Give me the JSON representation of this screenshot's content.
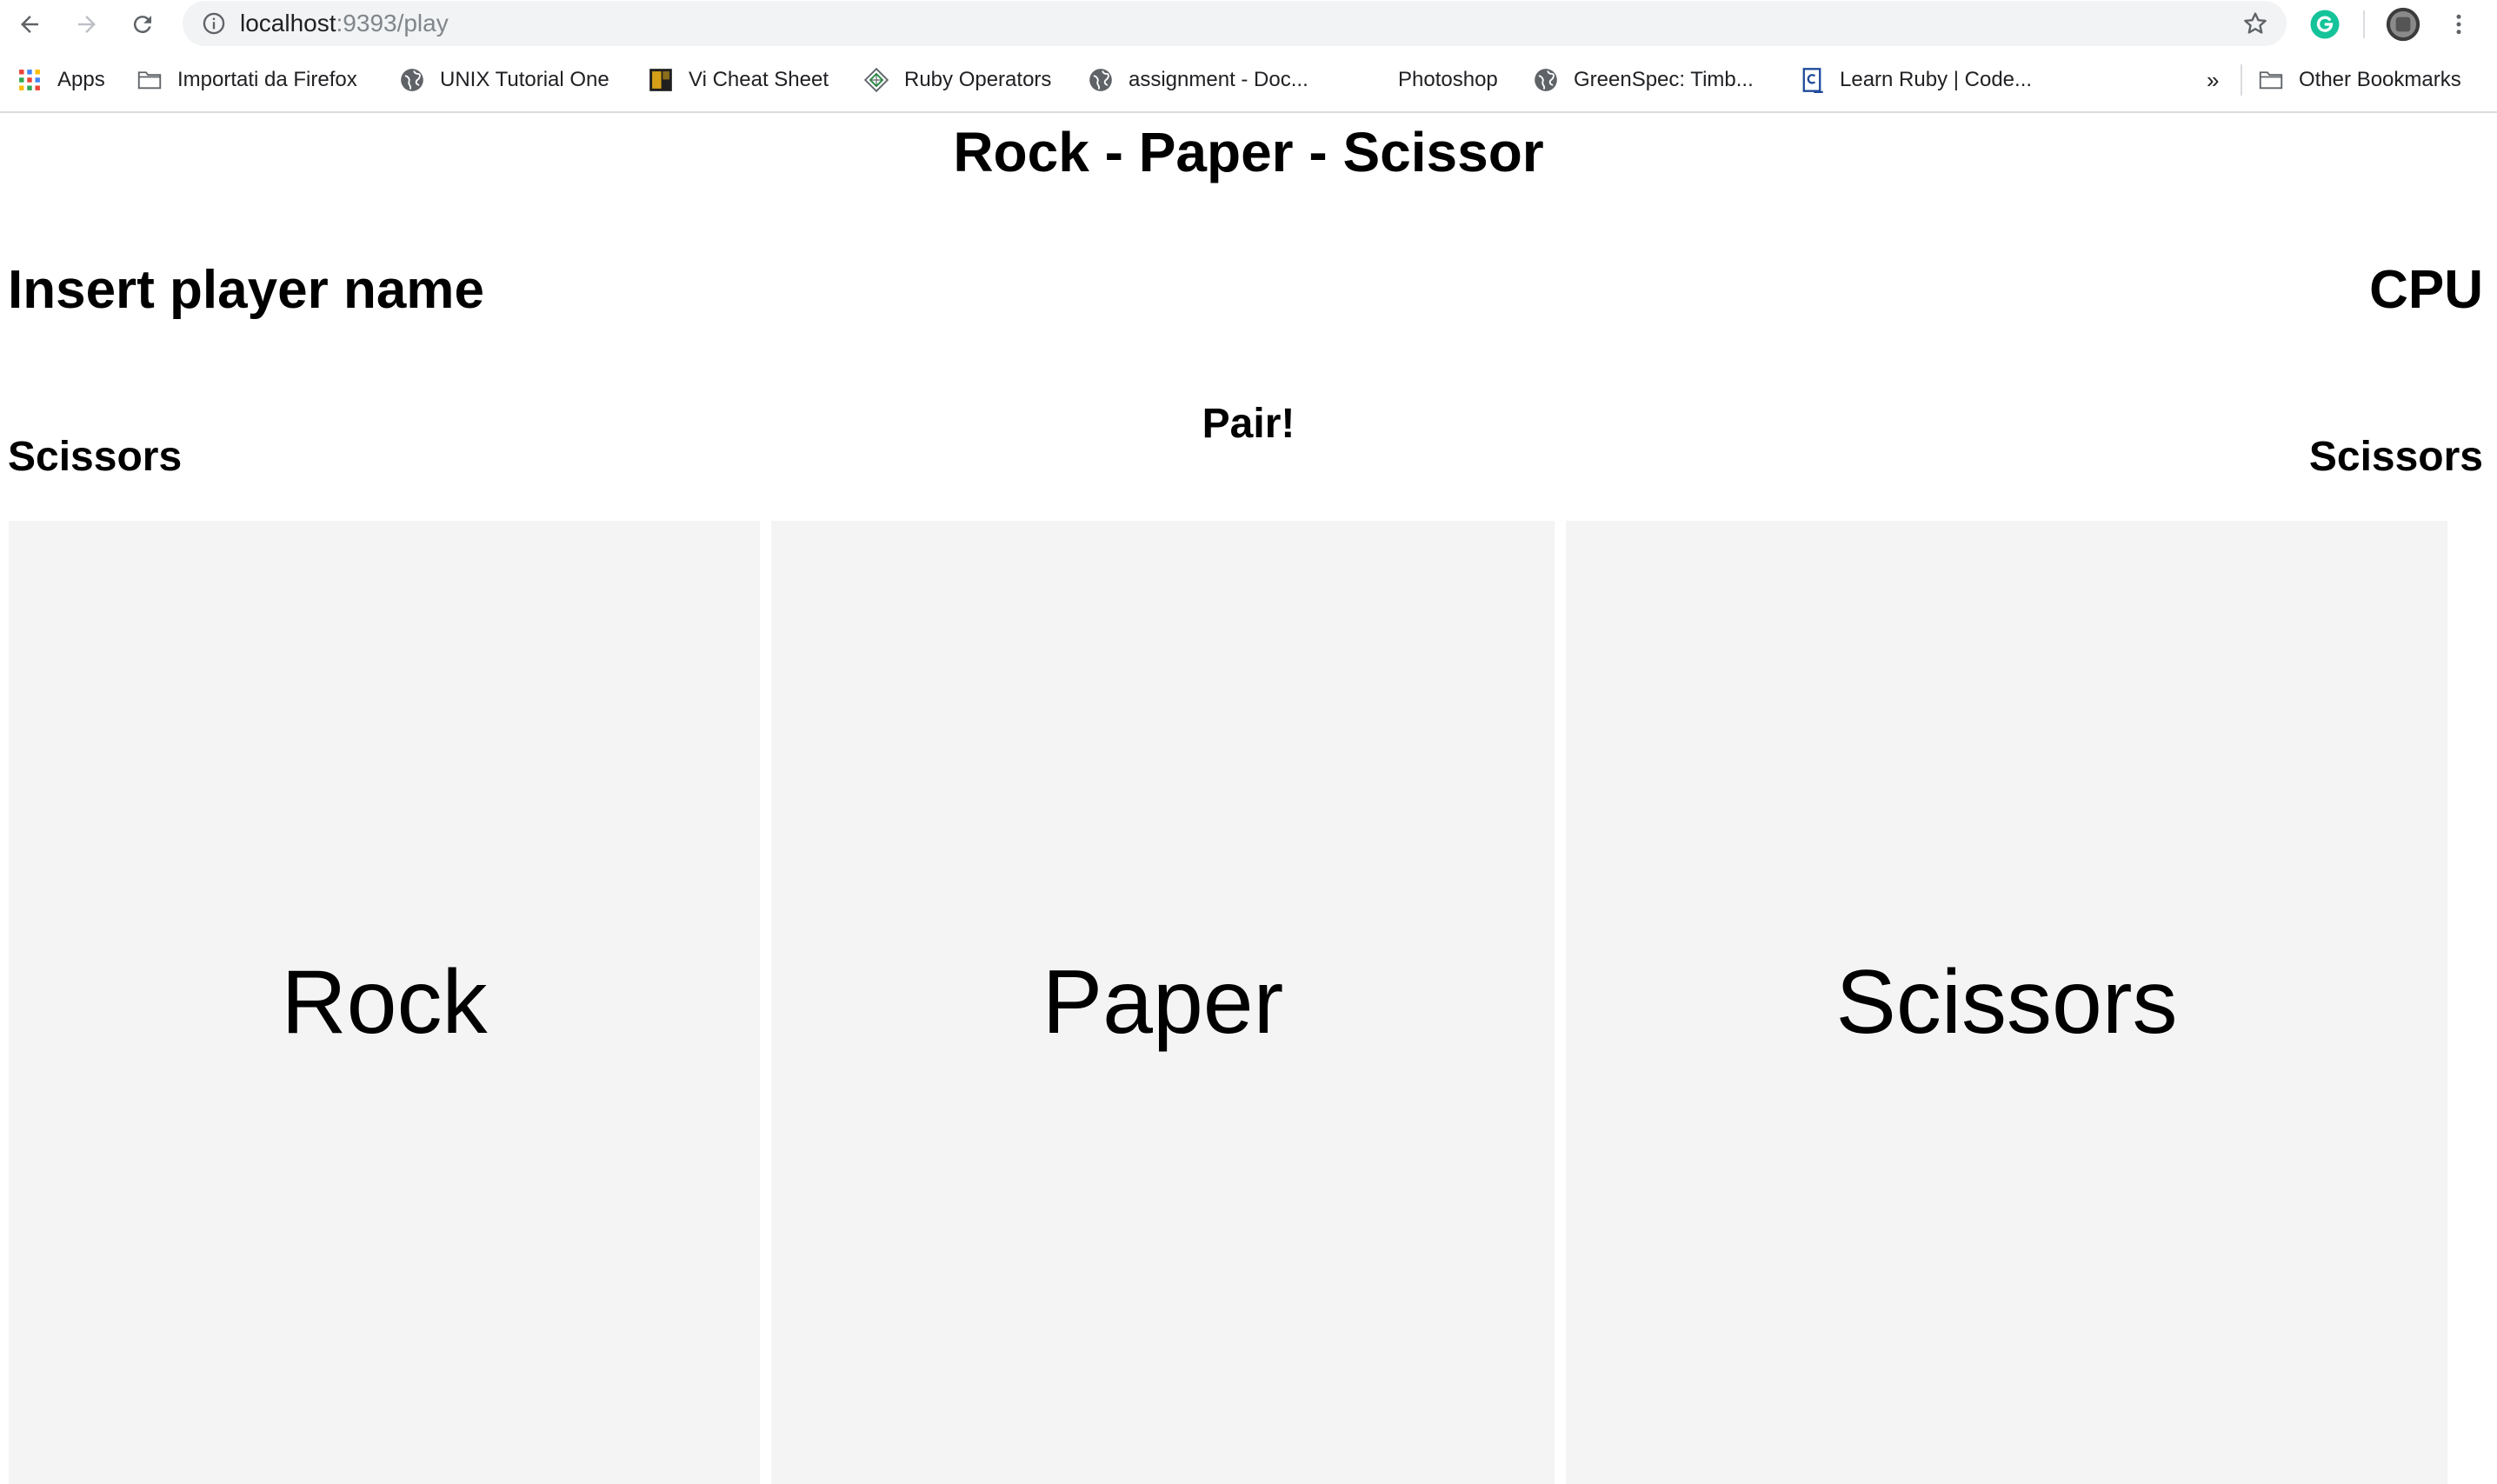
{
  "browser": {
    "url_host": "localhost",
    "url_rest": ":9393/play",
    "bookmarks": [
      {
        "label": "Apps",
        "icon": "apps-grid-icon"
      },
      {
        "label": "Importati da Firefox",
        "icon": "folder-icon"
      },
      {
        "label": "UNIX Tutorial One",
        "icon": "globe-icon"
      },
      {
        "label": "Vi Cheat Sheet",
        "icon": "vi-sheet-icon"
      },
      {
        "label": "Ruby Operators",
        "icon": "ruby-diamond-icon"
      },
      {
        "label": "assignment - Doc...",
        "icon": "globe-icon"
      },
      {
        "label": "Photoshop",
        "icon": ""
      },
      {
        "label": "GreenSpec: Timb...",
        "icon": "globe-icon"
      },
      {
        "label": "Learn Ruby | Code...",
        "icon": "codecademy-icon"
      }
    ],
    "overflow_label": "»",
    "other_bookmarks": "Other Bookmarks",
    "accent_color": "#1a73e8",
    "grammarly_color": "#15c39a"
  },
  "page": {
    "title": "Rock - Paper - Scissor",
    "player_label": "Insert player name",
    "cpu_label": "CPU",
    "result": "Pair!",
    "player_choice": "Scissors",
    "cpu_choice": "Scissors",
    "cards": [
      {
        "label": "Rock"
      },
      {
        "label": "Paper"
      },
      {
        "label": "Scissors"
      }
    ]
  }
}
